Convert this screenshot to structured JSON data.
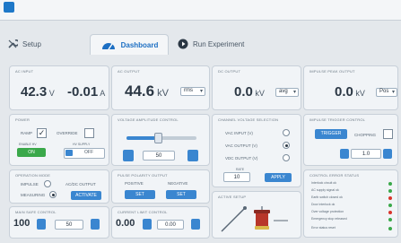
{
  "header": {
    "desc_line1": "",
    "desc_line2": "",
    "desc_line3": "",
    "mid_text": "",
    "right_line1": "",
    "right_line2": "",
    "right_line3": ""
  },
  "tabs": [
    {
      "label": "Setup"
    },
    {
      "label": "Dashboard"
    },
    {
      "label": "Run Experiment"
    }
  ],
  "readouts": {
    "voltage_value": "42.3",
    "voltage_unit": "V",
    "current_value": "-0.01",
    "current_unit": "A",
    "kv_value": "44.6",
    "kv_unit": "kV",
    "kv_mode": "rms",
    "kv2_value": "0.0",
    "kv2_unit": "kV",
    "kv2_mode": "avg",
    "kv3_value": "0.0",
    "kv3_unit": "kV",
    "kv3_mode": "Pos"
  },
  "power": {
    "title": "POWER",
    "ramp_label": "RAMP",
    "ramp_checked": "✓",
    "override_label": "OVERRIDE",
    "enable_label": "ENABLE HV",
    "on_label": "ON",
    "hv_label": "HV SUPPLY",
    "off_label": "OFF"
  },
  "amplitude": {
    "title": "VOLTAGE AMPLITUDE CONTROL",
    "value": "50",
    "slider_level": 0.45
  },
  "channel": {
    "title": "CHANNEL VOLTAGE SELECTION",
    "options": [
      "VAC INPUT (V)",
      "VAC OUTPUT (V)",
      "VDC OUTPUT (V)"
    ],
    "selected_index": 1,
    "rate_label": "RATE",
    "rate_value": "10",
    "apply_label": "APPLY"
  },
  "impulse": {
    "title": "IMPULSE TRIGGER CONTROL",
    "trigger_label": "TRIGGER",
    "chopping_label": "CHOPPING",
    "value": "1.0"
  },
  "mode": {
    "title": "OPERATION MODE",
    "impulse_label": "IMPULSE",
    "ac_label": "AC/DC OUTPUT",
    "measuring_label": "MEASURING",
    "activate_label": "ACTIVATE"
  },
  "polarity": {
    "title": "PULSE POLARITY OUTPUT",
    "pos_label": "POSITIVE",
    "neg_label": "NEGATIVE",
    "btn1": "SET",
    "btn2": "SET"
  },
  "bottom": {
    "left_title": "MAIN SAFE CONTROL",
    "left_value1": "100",
    "left_value2": "50",
    "mid_title": "CURRENT LIMIT CONTROL",
    "mid_value1": "0.00",
    "mid_value2": "0.00",
    "active_title": "ACTIVE SETUP"
  },
  "status": {
    "title": "CONTROL ERROR STATUS",
    "rows": [
      {
        "label": "Interlock circuit ok",
        "color": "#3aa84a"
      },
      {
        "label": "AC supply signal ok",
        "color": "#3aa84a"
      },
      {
        "label": "Earth switch closed ok",
        "color": "#d9342b"
      },
      {
        "label": "Door interlock ok",
        "color": "#3aa84a"
      },
      {
        "label": "Over voltage protection",
        "color": "#d9342b"
      },
      {
        "label": "Emergency stop released",
        "color": "#3aa84a"
      }
    ],
    "footer": "Error status reset"
  },
  "colors": {
    "accent": "#1d6fc3",
    "button": "#3a86d0",
    "green": "#3aa84a",
    "red": "#d9342b"
  }
}
